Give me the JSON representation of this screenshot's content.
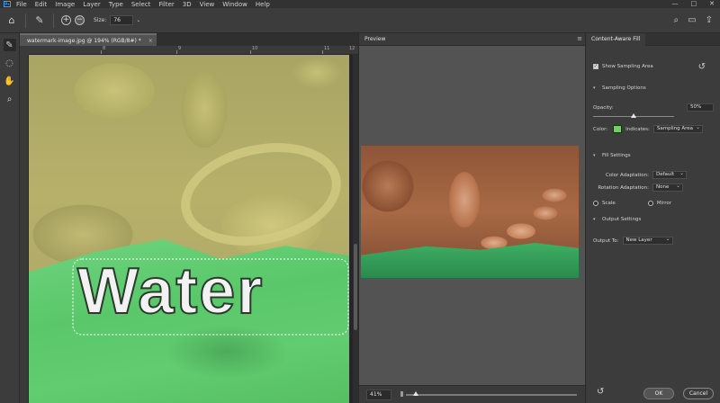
{
  "menu": {
    "logo": "Ps",
    "items": [
      "File",
      "Edit",
      "Image",
      "Layer",
      "Type",
      "Select",
      "Filter",
      "3D",
      "View",
      "Window",
      "Help"
    ],
    "window_buttons": [
      "—",
      "□",
      "✕"
    ]
  },
  "options": {
    "size_label": "Size:",
    "size_value": "76"
  },
  "document": {
    "tab_title": "watermark-image.jpg @ 194% (RGB/8#) *",
    "close_glyph": "×",
    "ruler_ticks": [
      "8",
      "9",
      "10",
      "11",
      "12"
    ],
    "watermark_text": "Water"
  },
  "preview": {
    "title": "Preview",
    "zoom_value": "41%",
    "zoom_level": 0.06
  },
  "caf": {
    "tab_title": "Content-Aware Fill",
    "show_sampling_area": "Show Sampling Area",
    "sampling_options": "Sampling Options",
    "opacity_label": "Opacity:",
    "opacity_value": "50%",
    "opacity_level": 0.5,
    "color_label": "Color:",
    "color_value": "#6ed15f",
    "indicates_label": "Indicates:",
    "indicates_value": "Sampling Area",
    "fill_settings": "Fill Settings",
    "color_adaptation_label": "Color Adaptation:",
    "color_adaptation_value": "Default",
    "rotation_adaptation_label": "Rotation Adaptation:",
    "rotation_adaptation_value": "None",
    "scale_label": "Scale",
    "mirror_label": "Mirror",
    "output_settings": "Output Settings",
    "output_to_label": "Output To:",
    "output_to_value": "New Layer",
    "ok_label": "OK",
    "cancel_label": "Cancel"
  }
}
